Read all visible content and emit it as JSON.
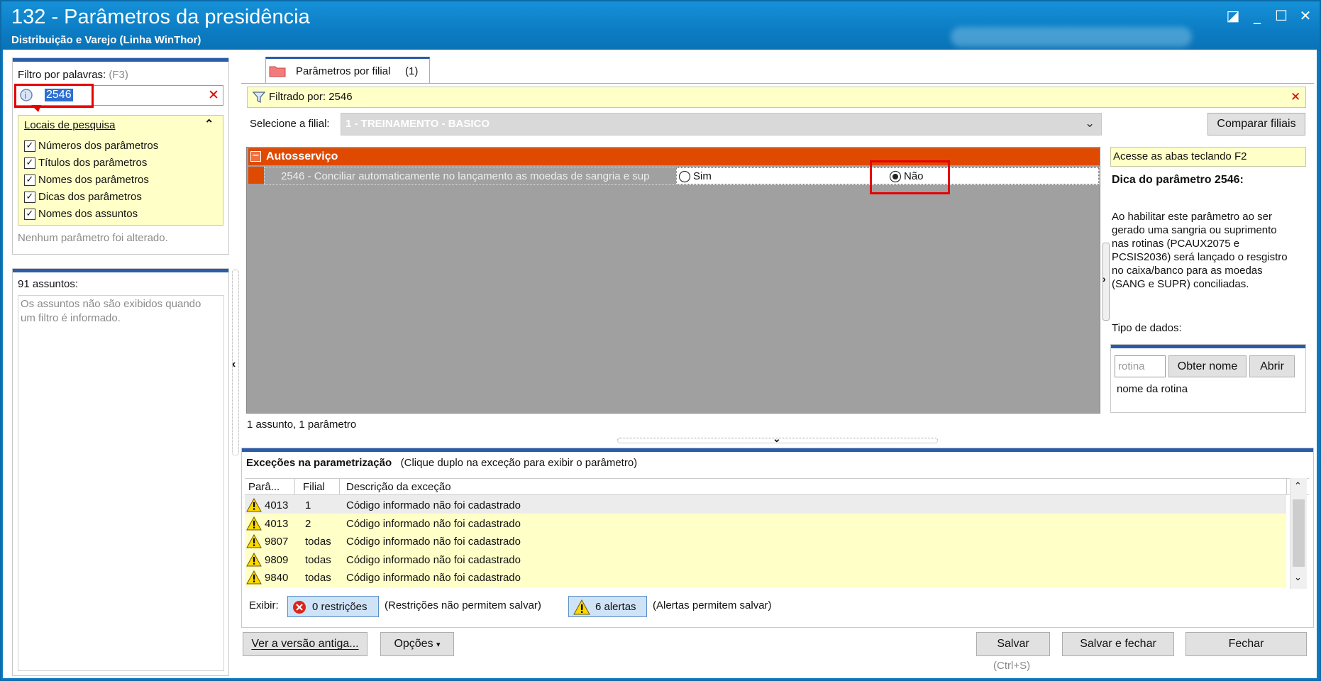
{
  "window": {
    "title": "132 - Parâmetros da presidência",
    "subtitle": "Distribuição e Varejo (Linha WinThor)",
    "controls": {
      "restore": "◪",
      "minimize": "_",
      "maximize": "☐",
      "close": "✕"
    }
  },
  "filter": {
    "label": "Filtro por palavras:",
    "shortcut": "(F3)",
    "value": "2546",
    "search_locations_title": "Locais de pesquisa",
    "options": [
      {
        "label": "Números dos parâmetros",
        "checked": true
      },
      {
        "label": "Títulos dos parâmetros",
        "checked": true
      },
      {
        "label": "Nomes dos parâmetros",
        "checked": true
      },
      {
        "label": "Dicas dos parâmetros",
        "checked": true
      },
      {
        "label": "Nomes dos assuntos",
        "checked": true
      }
    ],
    "status": "Nenhum parâmetro foi alterado."
  },
  "subjects": {
    "count_label": "91 assuntos:",
    "info": "Os assuntos não são exibidos quando um filtro é informado.",
    "info_line1": "Os assuntos não são exibidos quando",
    "info_line2": "um filtro é informado."
  },
  "tabs": [
    {
      "label": "Parâmetros por filial",
      "count": "(1)"
    }
  ],
  "filtered_bar": {
    "label": "Filtrado por: 2546"
  },
  "branch": {
    "label": "Selecione a filial:",
    "value": "1 - TREINAMENTO - BASICO",
    "compare_button": "Comparar filiais"
  },
  "group": {
    "toggle": "−",
    "name": "Autosserviço",
    "parameter": "2546 - Conciliar automaticamente no lançamento as moedas de sangria e sup",
    "options": [
      {
        "label": "Sim",
        "selected": false
      },
      {
        "label": "Não",
        "selected": true
      }
    ]
  },
  "grid_status": "1 assunto, 1 parâmetro",
  "help": {
    "tip_bar": "Acesse as abas teclando F2",
    "title": "Dica do parâmetro 2546:",
    "lines": [
      "Ao habilitar este parâmetro ao ser",
      "gerado uma sangria ou suprimento",
      "nas rotinas  (PCAUX2075 e",
      "PCSIS2036) será lançado o resgistro",
      "no caixa/banco para as moedas",
      "(SANG e SUPR) conciliadas."
    ],
    "data_type_label": "Tipo de dados:",
    "routine_placeholder": "rotina",
    "get_name_button": "Obter nome",
    "open_button": "Abrir",
    "routine_name_label": "nome da rotina"
  },
  "exceptions": {
    "title": "Exceções na parametrização",
    "hint": "(Clique duplo na exceção para exibir o parâmetro)",
    "columns": [
      "Parâ...",
      "Filial",
      "Descrição da exceção"
    ],
    "rows": [
      {
        "param": "4013",
        "branch": "1",
        "description": "Código informado não foi cadastrado"
      },
      {
        "param": "4013",
        "branch": "2",
        "description": "Código informado não foi cadastrado"
      },
      {
        "param": "9807",
        "branch": "todas",
        "description": "Código informado não foi cadastrado"
      },
      {
        "param": "9809",
        "branch": "todas",
        "description": "Código informado não foi cadastrado"
      },
      {
        "param": "9840",
        "branch": "todas",
        "description": "Código informado não foi cadastrado"
      }
    ],
    "show_label": "Exibir:",
    "restrictions_button": "0 restrições",
    "restrictions_note": "(Restrições não permitem salvar)",
    "alerts_button": "6 alertas",
    "alerts_note": "(Alertas permitem salvar)"
  },
  "footer": {
    "old_version_button": "Ver a versão antiga...",
    "options_button": "Opções",
    "save_button": "Salvar",
    "save_shortcut": "(Ctrl+S)",
    "save_close_button": "Salvar e fechar",
    "close_button": "Fechar"
  },
  "colors": {
    "title_bar": "#0c7cc3",
    "group_header": "#e04a00",
    "highlight_red": "#e60000",
    "yellow_bg": "#ffffc8",
    "accent_blue": "#2a5ca8"
  }
}
